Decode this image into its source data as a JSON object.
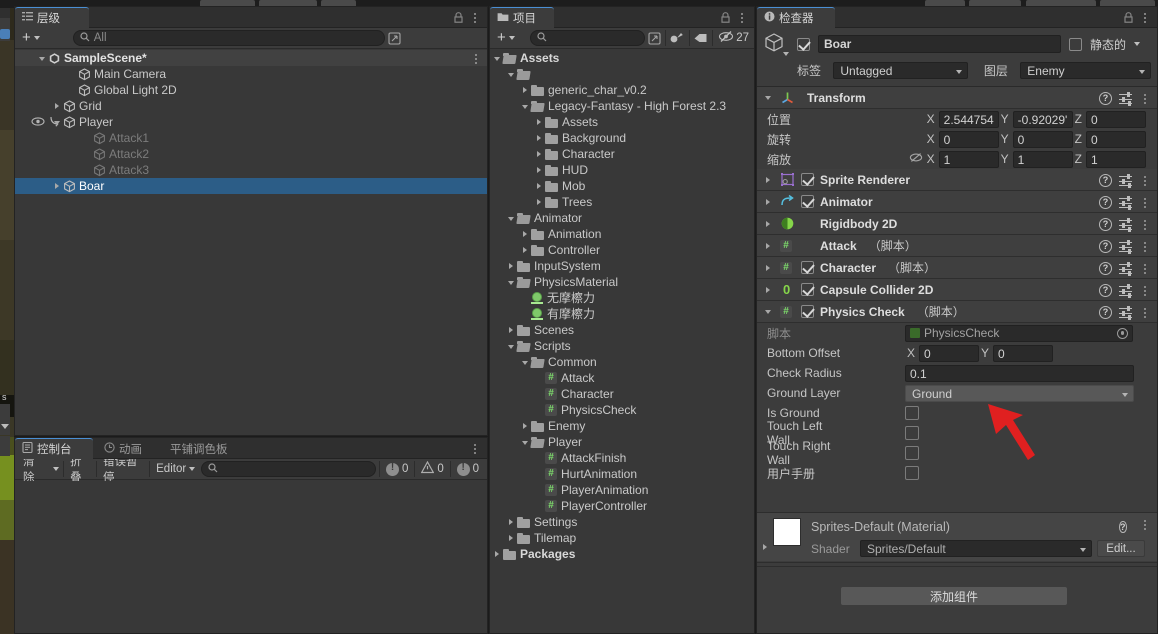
{
  "app": "Unity Editor",
  "hierarchy": {
    "tab_label": "层级",
    "tab_icon": "hierarchy-icon",
    "add_label": "+",
    "search_placeholder": "All",
    "items": [
      {
        "label": "SampleScene*",
        "depth": 0,
        "icon": "unity-scene-icon",
        "expand": "down",
        "state": "scene"
      },
      {
        "label": "Main Camera",
        "depth": 2,
        "icon": "gameobject-icon",
        "expand": "none",
        "state": "normal"
      },
      {
        "label": "Global Light 2D",
        "depth": 2,
        "icon": "gameobject-icon",
        "expand": "none",
        "state": "normal"
      },
      {
        "label": "Grid",
        "depth": 1,
        "icon": "gameobject-icon",
        "expand": "right",
        "state": "normal"
      },
      {
        "label": "Player",
        "depth": 1,
        "icon": "gameobject-icon",
        "expand": "down",
        "state": "normal",
        "vis": true
      },
      {
        "label": "Attack1",
        "depth": 3,
        "icon": "gameobject-icon",
        "expand": "none",
        "state": "dim"
      },
      {
        "label": "Attack2",
        "depth": 3,
        "icon": "gameobject-icon",
        "expand": "none",
        "state": "dim"
      },
      {
        "label": "Attack3",
        "depth": 3,
        "icon": "gameobject-icon",
        "expand": "none",
        "state": "dim"
      },
      {
        "label": "Boar",
        "depth": 1,
        "icon": "gameobject-icon",
        "expand": "right",
        "state": "selected"
      }
    ]
  },
  "project": {
    "tab_label": "项目",
    "tab_icon": "folder-icon",
    "add_label": "+",
    "search_placeholder": "",
    "toolbar_icons": [
      "save-search-icon",
      "label-icon",
      "hidden-packages-icon"
    ],
    "hidden_count": "27",
    "items": [
      {
        "label": "Assets",
        "depth": 0,
        "icon": "folder-open",
        "expand": "down",
        "bold": true
      },
      {
        "label": "",
        "depth": 1,
        "icon": "folder-open",
        "expand": "down",
        "bold": false
      },
      {
        "label": "generic_char_v0.2",
        "depth": 2,
        "icon": "folder",
        "expand": "right",
        "bold": false
      },
      {
        "label": "Legacy-Fantasy - High Forest 2.3",
        "depth": 2,
        "icon": "folder-open",
        "expand": "down",
        "bold": false
      },
      {
        "label": "Assets",
        "depth": 3,
        "icon": "folder",
        "expand": "right",
        "bold": false
      },
      {
        "label": "Background",
        "depth": 3,
        "icon": "folder",
        "expand": "right",
        "bold": false
      },
      {
        "label": "Character",
        "depth": 3,
        "icon": "folder",
        "expand": "right",
        "bold": false
      },
      {
        "label": "HUD",
        "depth": 3,
        "icon": "folder",
        "expand": "right",
        "bold": false
      },
      {
        "label": "Mob",
        "depth": 3,
        "icon": "folder",
        "expand": "right",
        "bold": false
      },
      {
        "label": "Trees",
        "depth": 3,
        "icon": "folder",
        "expand": "right",
        "bold": false
      },
      {
        "label": "Animator",
        "depth": 1,
        "icon": "folder-open",
        "expand": "down",
        "bold": false
      },
      {
        "label": "Animation",
        "depth": 2,
        "icon": "folder",
        "expand": "right",
        "bold": false
      },
      {
        "label": "Controller",
        "depth": 2,
        "icon": "folder",
        "expand": "right",
        "bold": false
      },
      {
        "label": "InputSystem",
        "depth": 1,
        "icon": "folder",
        "expand": "right",
        "bold": false
      },
      {
        "label": "PhysicsMaterial",
        "depth": 1,
        "icon": "folder-open",
        "expand": "down",
        "bold": false
      },
      {
        "label": "无摩檫力",
        "depth": 2,
        "icon": "physics-material-icon",
        "expand": "none",
        "bold": false
      },
      {
        "label": "有摩檫力",
        "depth": 2,
        "icon": "physics-material-icon",
        "expand": "none",
        "bold": false
      },
      {
        "label": "Scenes",
        "depth": 1,
        "icon": "folder",
        "expand": "right",
        "bold": false
      },
      {
        "label": "Scripts",
        "depth": 1,
        "icon": "folder-open",
        "expand": "down",
        "bold": false
      },
      {
        "label": "Common",
        "depth": 2,
        "icon": "folder-open",
        "expand": "down",
        "bold": false
      },
      {
        "label": "Attack",
        "depth": 3,
        "icon": "cs-script-icon",
        "expand": "none",
        "bold": false
      },
      {
        "label": "Character",
        "depth": 3,
        "icon": "cs-script-icon",
        "expand": "none",
        "bold": false
      },
      {
        "label": "PhysicsCheck",
        "depth": 3,
        "icon": "cs-script-icon",
        "expand": "none",
        "bold": false
      },
      {
        "label": "Enemy",
        "depth": 2,
        "icon": "folder",
        "expand": "right",
        "bold": false
      },
      {
        "label": "Player",
        "depth": 2,
        "icon": "folder-open",
        "expand": "down",
        "bold": false
      },
      {
        "label": "AttackFinish",
        "depth": 3,
        "icon": "cs-script-icon",
        "expand": "none",
        "bold": false
      },
      {
        "label": "HurtAnimation",
        "depth": 3,
        "icon": "cs-script-icon",
        "expand": "none",
        "bold": false
      },
      {
        "label": "PlayerAnimation",
        "depth": 3,
        "icon": "cs-script-icon",
        "expand": "none",
        "bold": false
      },
      {
        "label": "PlayerController",
        "depth": 3,
        "icon": "cs-script-icon",
        "expand": "none",
        "bold": false
      },
      {
        "label": "Settings",
        "depth": 1,
        "icon": "folder",
        "expand": "right",
        "bold": false
      },
      {
        "label": "Tilemap",
        "depth": 1,
        "icon": "folder",
        "expand": "right",
        "bold": false
      },
      {
        "label": "Packages",
        "depth": 0,
        "icon": "folder",
        "expand": "right",
        "bold": true
      }
    ]
  },
  "console": {
    "tabs": [
      {
        "label": "控制台",
        "icon": "console-icon",
        "active": true
      },
      {
        "label": "动画",
        "icon": "clock-icon",
        "active": false
      },
      {
        "label": "平铺调色板",
        "icon": "",
        "active": false
      }
    ],
    "clear_label": "清除",
    "collapse_label": "折叠",
    "error_pause_label": "错误暂停",
    "editor_label": "Editor",
    "search_placeholder": "",
    "counts": {
      "error": "0",
      "warning": "0",
      "info": "0"
    }
  },
  "inspector": {
    "tab_label": "检查器",
    "tab_icon": "info-icon",
    "object_name": "Boar",
    "enabled": true,
    "static_label": "静态的",
    "static_checked": false,
    "tag_label": "标签",
    "tag_value": "Untagged",
    "layer_label": "图层",
    "layer_value": "Enemy",
    "transform": {
      "title": "Transform",
      "icon": "transform-icon",
      "rows": [
        {
          "label": "位置",
          "x": "2.544754",
          "y": "-0.92029'",
          "z": "0",
          "lock": false
        },
        {
          "label": "旋转",
          "x": "0",
          "y": "0",
          "z": "0",
          "lock": false
        },
        {
          "label": "缩放",
          "x": "1",
          "y": "1",
          "z": "1",
          "lock": true
        }
      ]
    },
    "components": [
      {
        "name": "Sprite Renderer",
        "suffix": "",
        "icon": "sprite-renderer-icon",
        "checkbox": true,
        "checked": true,
        "expanded": false
      },
      {
        "name": "Animator",
        "suffix": "",
        "icon": "animator-icon",
        "checkbox": true,
        "checked": true,
        "expanded": false
      },
      {
        "name": "Rigidbody 2D",
        "suffix": "",
        "icon": "rigidbody2d-icon",
        "checkbox": false,
        "checked": false,
        "expanded": false
      },
      {
        "name": "Attack",
        "suffix": "（脚本）",
        "icon": "cs-script-icon",
        "checkbox": false,
        "checked": false,
        "expanded": false
      },
      {
        "name": "Character",
        "suffix": "（脚本）",
        "icon": "cs-script-icon",
        "checkbox": true,
        "checked": true,
        "expanded": false
      },
      {
        "name": "Capsule Collider 2D",
        "suffix": "",
        "icon": "capsule-collider2d-icon",
        "checkbox": true,
        "checked": true,
        "expanded": false
      },
      {
        "name": "Physics Check",
        "suffix": "（脚本）",
        "icon": "cs-script-icon",
        "checkbox": true,
        "checked": true,
        "expanded": true
      }
    ],
    "physics_check": {
      "script_label": "脚本",
      "script_value": "PhysicsCheck",
      "fields": [
        {
          "label": "Bottom Offset",
          "type": "vector2",
          "x": "0",
          "y": "0"
        },
        {
          "label": "Check Radius",
          "type": "float",
          "value": "0.1"
        },
        {
          "label": "Ground Layer",
          "type": "layermask",
          "value": "Ground"
        },
        {
          "label": "Is Ground",
          "type": "bool",
          "value": false
        },
        {
          "label": "Touch Left Wall",
          "type": "bool",
          "value": false
        },
        {
          "label": "Touch Right Wall",
          "type": "bool",
          "value": false
        },
        {
          "label": "用户手册",
          "type": "bool",
          "value": false
        }
      ]
    },
    "material": {
      "title": "Sprites-Default (Material)",
      "shader_label": "Shader",
      "shader_value": "Sprites/Default",
      "edit_label": "Edit..."
    },
    "add_component_label": "添加组件"
  },
  "annotation": {
    "arrow": "red-arrow-pointing-to-ground-layer",
    "color": "#e02020"
  }
}
